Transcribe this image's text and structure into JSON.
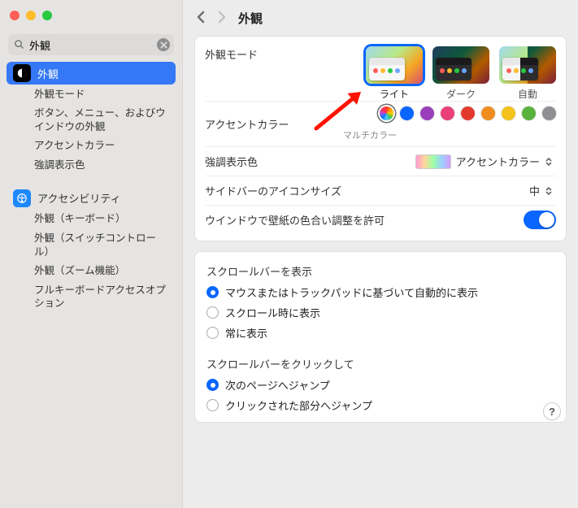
{
  "search": {
    "value": "外観"
  },
  "sidebar": {
    "main": {
      "label": "外観"
    },
    "subitems": [
      "外観モード",
      "ボタン、メニュー、およびウインドウの外観",
      "アクセントカラー",
      "強調表示色"
    ],
    "accessibility": {
      "label": "アクセシビリティ"
    },
    "accessibility_subs": [
      "外観（キーボード）",
      "外観（スイッチコントロール）",
      "外観（ズーム機能）",
      "フルキーボードアクセスオプション"
    ]
  },
  "header": {
    "title": "外観"
  },
  "appearance": {
    "section_label": "外観モード",
    "options": {
      "light": "ライト",
      "dark": "ダーク",
      "auto": "自動"
    },
    "selected": "light"
  },
  "accent": {
    "label": "アクセントカラー",
    "caption": "マルチカラー",
    "colors": [
      "multicolor",
      "#0a66ff",
      "#9a3fbb",
      "#e9407a",
      "#e23b2e",
      "#f08d1e",
      "#f4c21a",
      "#58b23c",
      "#8e8e93"
    ],
    "selected": 0
  },
  "highlight": {
    "label": "強調表示色",
    "value": "アクセントカラー"
  },
  "sidebar_icon": {
    "label": "サイドバーのアイコンサイズ",
    "value": "中"
  },
  "tint": {
    "label": "ウインドウで壁紙の色合い調整を許可",
    "on": true
  },
  "scrollbars_show": {
    "title": "スクロールバーを表示",
    "options": [
      "マウスまたはトラックパッドに基づいて自動的に表示",
      "スクロール時に表示",
      "常に表示"
    ],
    "selected": 0
  },
  "scrollbars_click": {
    "title": "スクロールバーをクリックして",
    "options": [
      "次のページへジャンプ",
      "クリックされた部分へジャンプ"
    ],
    "selected": 0
  },
  "help": "?"
}
